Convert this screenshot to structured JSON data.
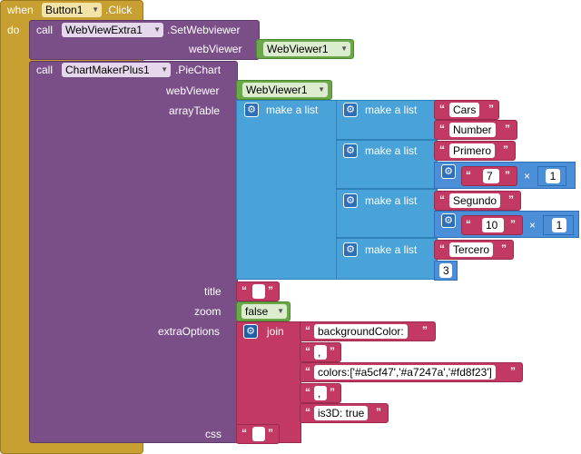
{
  "event": {
    "when": "when",
    "component": "Button1",
    "event": ".Click",
    "do": "do"
  },
  "call1": {
    "call": "call",
    "component": "WebViewExtra1",
    "method": ".SetWebviewer",
    "param": "webViewer",
    "value": "WebViewer1"
  },
  "call2": {
    "call": "call",
    "component": "ChartMakerPlus1",
    "method": ".PieChart",
    "params": {
      "webViewer": "webViewer",
      "arrayTable": "arrayTable",
      "title": "title",
      "zoom": "zoom",
      "extraOptions": "extraOptions",
      "css": "css"
    },
    "webViewer_value": "WebViewer1",
    "make_a_list": "make a list",
    "rows": [
      {
        "first": "Cars",
        "second": "Number"
      },
      {
        "first": "Primero",
        "mult_left": "7",
        "mult_op": "×",
        "mult_right": "1"
      },
      {
        "first": "Segundo",
        "mult_left": "10",
        "mult_op": "×",
        "mult_right": "1"
      },
      {
        "first": "Tercero",
        "number": "3"
      }
    ],
    "title_value": "",
    "zoom_value": "false",
    "join": "join",
    "join_items": [
      "backgroundColor:",
      ",",
      "colors:['#a5cf47','#a7247a','#fd8f23']",
      ",",
      "is3D: true"
    ],
    "css_value": ""
  }
}
